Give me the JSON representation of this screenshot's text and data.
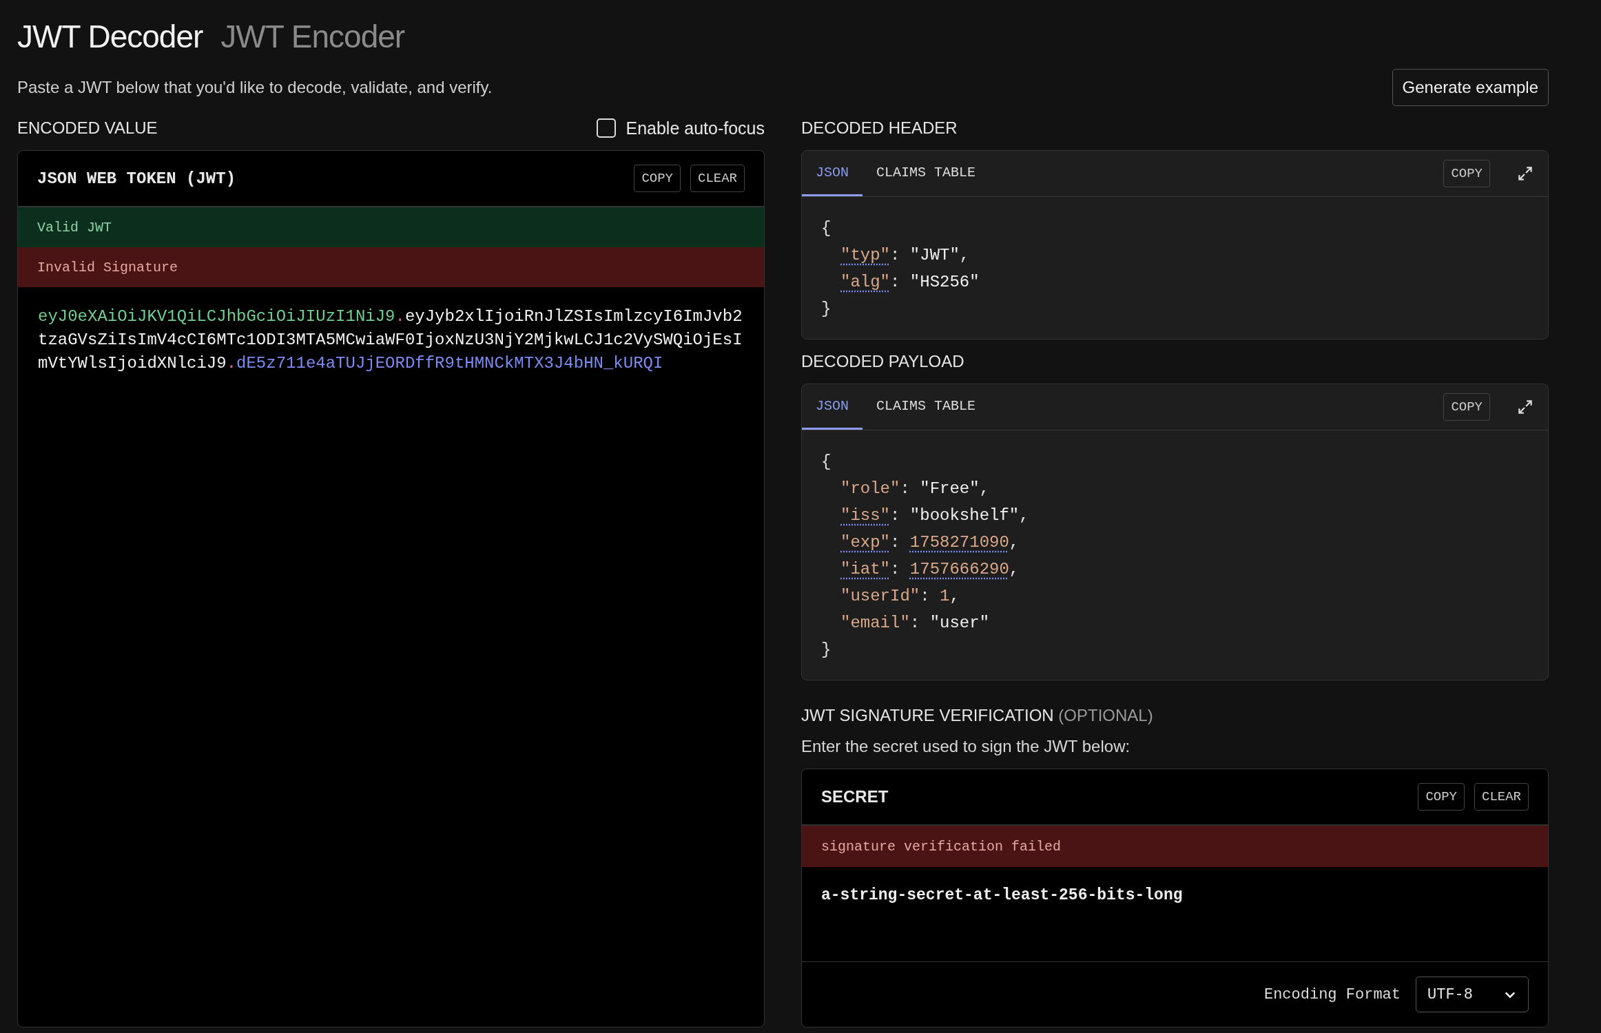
{
  "tabs": [
    {
      "label": "JWT Decoder",
      "selected": true
    },
    {
      "label": "JWT Encoder",
      "selected": false
    }
  ],
  "intro": "Paste a JWT below that you'd like to decode, validate, and verify.",
  "generate_button": "Generate example",
  "encoded": {
    "label": "ENCODED VALUE",
    "autofocus": {
      "label": "Enable auto-focus",
      "checked": false
    },
    "panel_title": "JSON WEB TOKEN (JWT)",
    "buttons": [
      "COPY",
      "CLEAR"
    ],
    "statuses": [
      {
        "text": "Valid JWT",
        "kind": "success"
      },
      {
        "text": "Invalid Signature",
        "kind": "error"
      }
    ],
    "token_parts": [
      {
        "text": "eyJ0eXAiOiJKV1QiLCJhbGciOiJIUzI1NiJ9",
        "kind": "header"
      },
      {
        "text": ".",
        "kind": "dot"
      },
      {
        "text": "eyJyb2xlIjoiRnJlZSIsImlzcyI6ImJvb2tzaGVsZiIsImV4cCI6MTc1ODI3MTA5MCwiaWF0IjoxNzU3NjY2MjkwLCJ1c2VySWQiOjEsImVtYWlsIjoidXNlciJ9",
        "kind": "payload"
      },
      {
        "text": ".",
        "kind": "dot"
      },
      {
        "text": "dE5z711e4aTUJjEORDffR9tHMNCkMTX3J4bHN_kURQI",
        "kind": "signature"
      }
    ]
  },
  "decoded": [
    {
      "label": "DECODED HEADER",
      "tabs": [
        {
          "label": "JSON",
          "selected": true
        },
        {
          "label": "CLAIMS TABLE",
          "selected": false
        }
      ],
      "copy": "COPY",
      "lines": [
        [
          {
            "text": "{",
            "kind": "punct"
          }
        ],
        [
          {
            "text": "\"typ\"",
            "kind": "key",
            "annotated": true
          },
          {
            "text": ": ",
            "kind": "punct"
          },
          {
            "text": "\"JWT\"",
            "kind": "string"
          },
          {
            "text": ",",
            "kind": "punct"
          }
        ],
        [
          {
            "text": "\"alg\"",
            "kind": "key",
            "annotated": true
          },
          {
            "text": ": ",
            "kind": "punct"
          },
          {
            "text": "\"HS256\"",
            "kind": "string"
          }
        ],
        [
          {
            "text": "}",
            "kind": "punct"
          }
        ]
      ]
    },
    {
      "label": "DECODED PAYLOAD",
      "tabs": [
        {
          "label": "JSON",
          "selected": true
        },
        {
          "label": "CLAIMS TABLE",
          "selected": false
        }
      ],
      "copy": "COPY",
      "lines": [
        [
          {
            "text": "{",
            "kind": "punct"
          }
        ],
        [
          {
            "text": "\"role\"",
            "kind": "key",
            "annotated": false
          },
          {
            "text": ": ",
            "kind": "punct"
          },
          {
            "text": "\"Free\"",
            "kind": "string"
          },
          {
            "text": ",",
            "kind": "punct"
          }
        ],
        [
          {
            "text": "\"iss\"",
            "kind": "key",
            "annotated": true
          },
          {
            "text": ": ",
            "kind": "punct"
          },
          {
            "text": "\"bookshelf\"",
            "kind": "string"
          },
          {
            "text": ",",
            "kind": "punct"
          }
        ],
        [
          {
            "text": "\"exp\"",
            "kind": "key",
            "annotated": true
          },
          {
            "text": ": ",
            "kind": "punct"
          },
          {
            "text": "1758271090",
            "kind": "number",
            "annotated": true
          },
          {
            "text": ",",
            "kind": "punct"
          }
        ],
        [
          {
            "text": "\"iat\"",
            "kind": "key",
            "annotated": true
          },
          {
            "text": ": ",
            "kind": "punct"
          },
          {
            "text": "1757666290",
            "kind": "number",
            "annotated": true
          },
          {
            "text": ",",
            "kind": "punct"
          }
        ],
        [
          {
            "text": "\"userId\"",
            "kind": "key",
            "annotated": false
          },
          {
            "text": ": ",
            "kind": "punct"
          },
          {
            "text": "1",
            "kind": "number",
            "annotated": false
          },
          {
            "text": ",",
            "kind": "punct"
          }
        ],
        [
          {
            "text": "\"email\"",
            "kind": "key",
            "annotated": false
          },
          {
            "text": ": ",
            "kind": "punct"
          },
          {
            "text": "\"user\"",
            "kind": "string"
          }
        ],
        [
          {
            "text": "}",
            "kind": "punct"
          }
        ]
      ]
    }
  ],
  "verification": {
    "label": "JWT SIGNATURE VERIFICATION",
    "label_note": "(OPTIONAL)",
    "help": "Enter the secret used to sign the JWT below:",
    "panel_title": "SECRET",
    "buttons": [
      "COPY",
      "CLEAR"
    ],
    "status": {
      "text": "signature verification failed",
      "kind": "error"
    },
    "secret": "a-string-secret-at-least-256-bits-long",
    "encoding_label": "Encoding Format",
    "encoding_value": "UTF-8"
  }
}
